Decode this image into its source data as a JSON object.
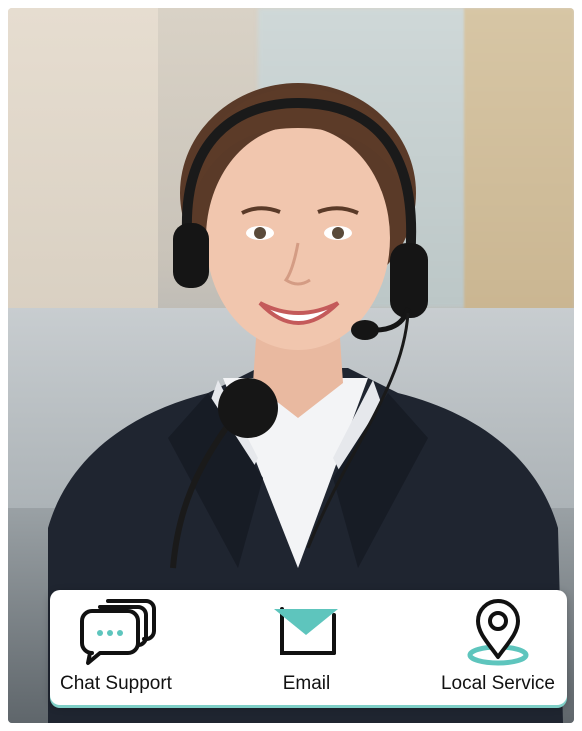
{
  "services": [
    {
      "label": "Chat Support",
      "icon": "chat-bubbles-icon"
    },
    {
      "label": "Email",
      "icon": "envelope-icon"
    },
    {
      "label": "Local Service",
      "icon": "location-pin-icon"
    }
  ],
  "colors": {
    "accent": "#5ec5bd",
    "icon_stroke": "#111111",
    "bar_background": "#ffffff"
  }
}
